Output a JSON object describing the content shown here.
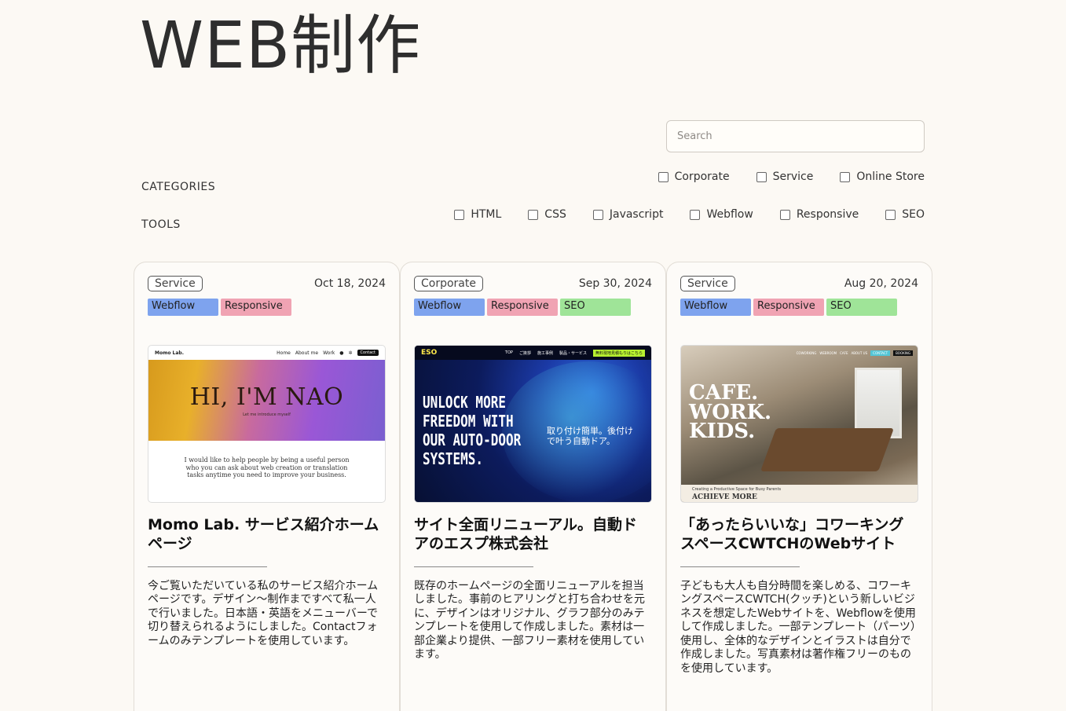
{
  "page": {
    "title": "WEB制作",
    "search_placeholder": "Search"
  },
  "filters": {
    "categories_label": "CATEGORIES",
    "tools_label": "TOOLS",
    "categories": [
      "Corporate",
      "Service",
      "Online Store"
    ],
    "tools": [
      "HTML",
      "CSS",
      "Javascript",
      "Webflow",
      "Responsive",
      "SEO"
    ]
  },
  "cards": [
    {
      "category": "Service",
      "date": "Oct 18, 2024",
      "tags": [
        "Webflow",
        "Responsive"
      ],
      "title": "Momo Lab. サービス紹介ホームページ",
      "description": "今ご覧いただいている私のサービス紹介ホームページです。デザイン〜制作まですべて私一人で行いました。日本語・英語をメニューバーで切り替えられるようにしました。Contactフォームのみテンプレートを使用しています。",
      "thumb": {
        "brand": "Momo Lab.",
        "nav": [
          "Home",
          "About me",
          "Work"
        ],
        "cta": "Contact",
        "headline": "HI, I'M NAO",
        "sub": "Let me introduce myself",
        "body": "I would like to help people by being a useful person who you can ask about web creation or translation tasks anytime you need to improve your business."
      }
    },
    {
      "category": "Corporate",
      "date": "Sep 30, 2024",
      "tags": [
        "Webflow",
        "Responsive",
        "SEO"
      ],
      "title": "サイト全面リニューアル。自動ドアのエスプ株式会社",
      "description": "既存のホームページの全面リニューアルを担当しました。事前のヒアリングと打ち合わせを元に、デザインはオリジナル、グラフ部分のみテンプレートを使用して作成しました。素材は一部企業より提供、一部フリー素材を使用しています。",
      "thumb": {
        "logo": "ESO",
        "nav": [
          "TOP",
          "ご挨拶",
          "施工事例",
          "製品・サービス"
        ],
        "cta": "無料現地見積もりはこちら",
        "headline": "UNLOCK MORE FREEDOM WITH OUR AUTO-DOOR SYSTEMS.",
        "jp": "取り付け簡単。後付けで叶う自動ドア。"
      }
    },
    {
      "category": "Service",
      "date": "Aug 20, 2024",
      "tags": [
        "Webflow",
        "Responsive",
        "SEO"
      ],
      "title": "「あったらいいな」コワーキングスペースCWTCHのWebサイト",
      "description": "子どもも大人も自分時間を楽しめる、コワーキングスペースCWTCH(クッチ)という新しいビジネスを想定したWebサイトを、Webflowを使用して作成しました。一部テンプレート（パーツ）使用し、全体的なデザインとイラストは自分で作成しました。写真素材は著作権フリーのものを使用しています。",
      "thumb": {
        "nav": [
          "COWORKING",
          "WEBROOM",
          "CAFE",
          "ABOUT US"
        ],
        "cta1": "CONTACT",
        "cta2": "BOOKING",
        "headline": "CAFE. WORK. KIDS.",
        "foot_small": "Creating a Productive Space for Busy Parents",
        "foot_big": "ACHIEVE MORE"
      }
    }
  ],
  "colors": {
    "background": "#fcf9f4",
    "webflow_tag": "#7ea3ee",
    "responsive_tag": "#f0a3b3",
    "seo_tag": "#9fe498"
  }
}
